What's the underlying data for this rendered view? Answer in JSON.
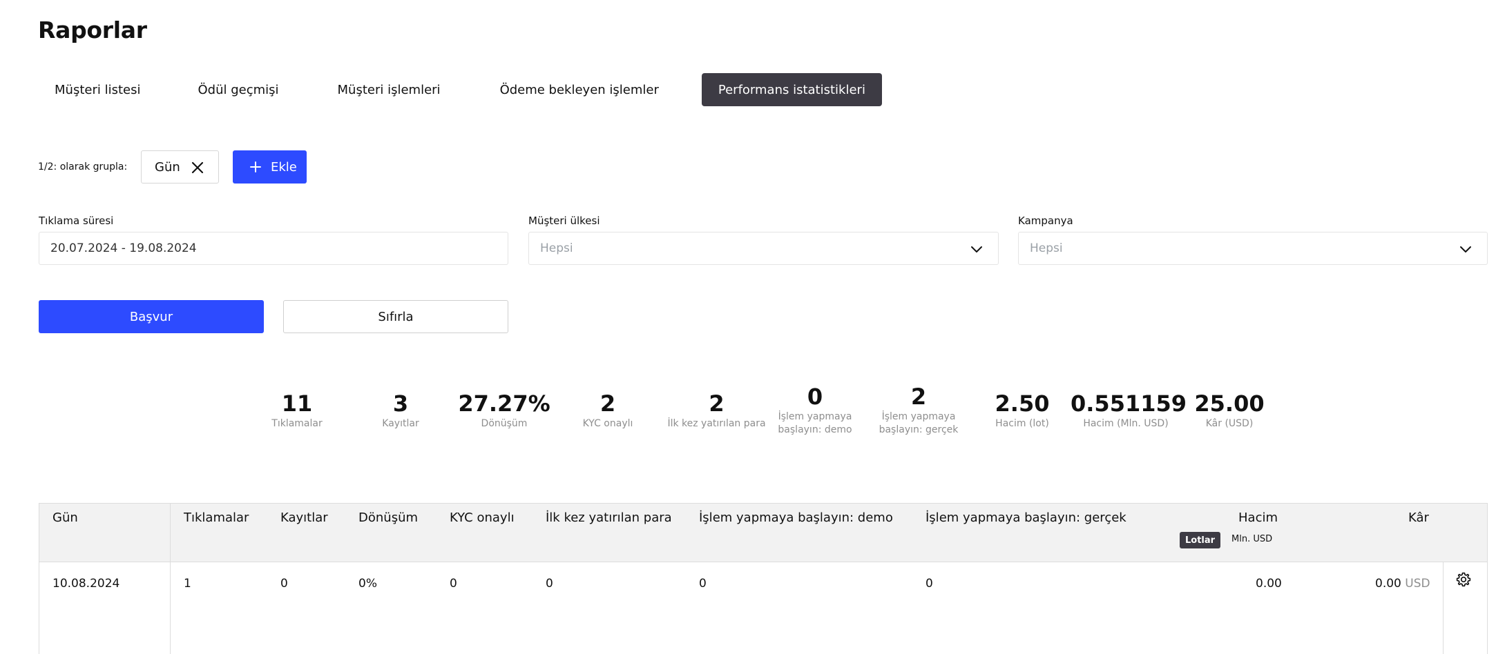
{
  "page": {
    "title": "Raporlar"
  },
  "tabs": [
    {
      "label": "Müşteri listesi"
    },
    {
      "label": "Ödül geçmişi"
    },
    {
      "label": "Müşteri işlemleri"
    },
    {
      "label": "Ödeme bekleyen işlemler"
    },
    {
      "label": "Performans istatistikleri",
      "active": true
    }
  ],
  "groupby": {
    "label": "1/2: olarak grupla:",
    "chip": "Gün",
    "add_label": "Ekle"
  },
  "filters": {
    "click_period": {
      "label": "Tıklama süresi",
      "value": "20.07.2024 - 19.08.2024"
    },
    "customer_country": {
      "label": "Müşteri ülkesi",
      "placeholder": "Hepsi"
    },
    "campaign": {
      "label": "Kampanya",
      "placeholder": "Hepsi"
    }
  },
  "buttons": {
    "apply": "Başvur",
    "reset": "Sıfırla"
  },
  "stats": [
    {
      "value": "11",
      "label": "Tıklamalar"
    },
    {
      "value": "3",
      "label": "Kayıtlar"
    },
    {
      "value": "27.27%",
      "label": "Dönüşüm"
    },
    {
      "value": "2",
      "label": "KYC onaylı"
    },
    {
      "value": "2",
      "label": "İlk kez yatırılan para"
    },
    {
      "value": "0",
      "label_line1": "İşlem yapmaya",
      "label_line2": "başlayın: demo"
    },
    {
      "value": "2",
      "label_line1": "İşlem yapmaya",
      "label_line2": "başlayın: gerçek"
    },
    {
      "value": "2.50",
      "label": "Hacim (lot)"
    },
    {
      "value": "0.551159",
      "label": "Hacim (Mln. USD)"
    },
    {
      "value": "25.00",
      "label": "Kâr (USD)"
    }
  ],
  "table": {
    "columns": [
      "Gün",
      "Tıklamalar",
      "Kayıtlar",
      "Dönüşüm",
      "KYC onaylı",
      "İlk kez yatırılan para",
      "İşlem yapmaya başlayın: demo",
      "İşlem yapmaya başlayın: gerçek",
      "Hacim",
      "Kâr"
    ],
    "volume_units": {
      "active": "Lotlar",
      "other": "Mln. USD"
    },
    "rows": [
      {
        "cells": [
          "10.08.2024",
          "1",
          "0",
          "0%",
          "0",
          "0",
          "0",
          "0",
          "0.00",
          "0.00"
        ],
        "currency": "USD"
      }
    ]
  },
  "colors": {
    "accent": "#2d4bff",
    "active_tab": "#3d3b44",
    "muted_text": "#8e8e8e"
  },
  "icons": [
    "close-icon",
    "plus-icon",
    "chevron-down-icon",
    "gear-icon"
  ]
}
